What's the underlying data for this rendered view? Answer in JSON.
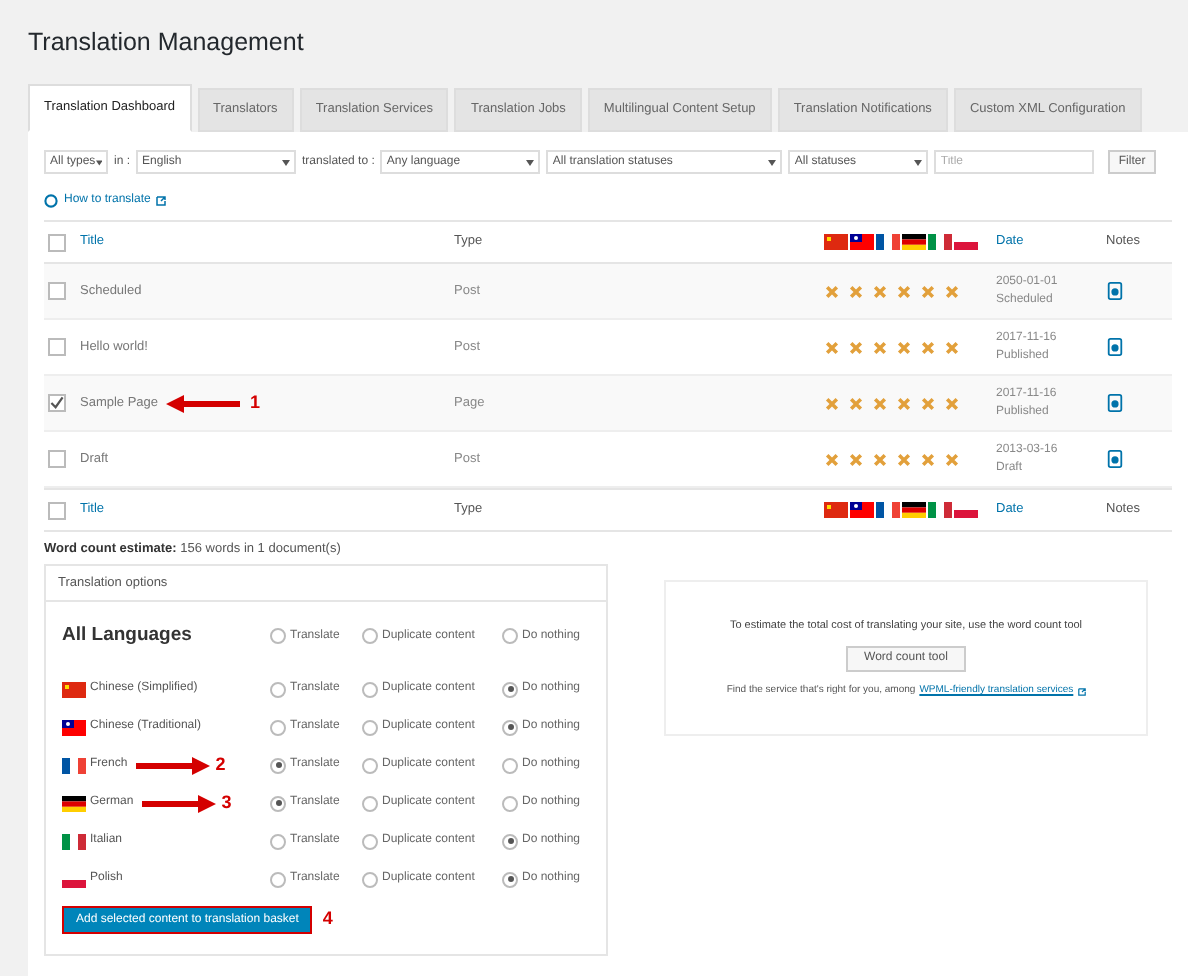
{
  "title": "Translation Management",
  "tabs": [
    {
      "label": "Translation Dashboard",
      "selected": true
    },
    {
      "label": "Translators",
      "selected": false
    },
    {
      "label": "Translation Services",
      "selected": false
    },
    {
      "label": "Translation Jobs",
      "selected": false
    },
    {
      "label": "Multilingual Content Setup",
      "selected": false
    },
    {
      "label": "Translation Notifications",
      "selected": false
    },
    {
      "label": "Custom XML Configuration",
      "selected": false
    }
  ],
  "filters": {
    "type": "All types",
    "in_label": "in :",
    "language": "English",
    "to_label": "translated to :",
    "target": "Any language",
    "translation_status": "All translation statuses",
    "status": "All statuses",
    "title_placeholder": "Title",
    "filter_button": "Filter"
  },
  "how_to_link": "How to translate",
  "table": {
    "header": {
      "checked": false,
      "title": "Title",
      "type": "Type",
      "date": "Date",
      "notes": "Notes",
      "flags": [
        {
          "kind": "cn"
        },
        {
          "kind": "tw"
        },
        {
          "kind": "fr"
        },
        {
          "kind": "de"
        },
        {
          "kind": "it"
        },
        {
          "kind": "pl"
        }
      ]
    },
    "footer": {
      "checked": false,
      "title": "Title",
      "type": "Type",
      "date": "Date",
      "notes": "Notes",
      "flags": [
        {
          "kind": "cn"
        },
        {
          "kind": "tw"
        },
        {
          "kind": "fr"
        },
        {
          "kind": "de"
        },
        {
          "kind": "it"
        },
        {
          "kind": "pl"
        }
      ]
    },
    "rows": [
      {
        "checked": false,
        "title": "Scheduled",
        "type": "Post",
        "date": "2050-01-01",
        "status": "Scheduled"
      },
      {
        "checked": false,
        "title": "Hello world!",
        "type": "Post",
        "date": "2017-11-16",
        "status": "Published"
      },
      {
        "checked": true,
        "title": "Sample Page",
        "type": "Page",
        "date": "2017-11-16",
        "status": "Published",
        "annotation": "1"
      },
      {
        "checked": false,
        "title": "Draft",
        "type": "Post",
        "date": "2013-03-16",
        "status": "Draft"
      }
    ]
  },
  "word_count": {
    "label": "Word count estimate:",
    "text": "156 words in 1 document(s)"
  },
  "options": {
    "header": "Translation options",
    "all_label": "All Languages",
    "all_options": [
      {
        "label": "Translate",
        "selected": false
      },
      {
        "label": "Duplicate content",
        "selected": false
      },
      {
        "label": "Do nothing",
        "selected": false
      }
    ],
    "languages": [
      {
        "kind": "cn",
        "name": "Chinese (Simplified)",
        "options": [
          {
            "label": "Translate",
            "selected": false
          },
          {
            "label": "Duplicate content",
            "selected": false
          },
          {
            "label": "Do nothing",
            "selected": true
          }
        ]
      },
      {
        "kind": "tw",
        "name": "Chinese (Traditional)",
        "options": [
          {
            "label": "Translate",
            "selected": false
          },
          {
            "label": "Duplicate content",
            "selected": false
          },
          {
            "label": "Do nothing",
            "selected": true
          }
        ]
      },
      {
        "kind": "fr",
        "name": "French",
        "annotation": "2",
        "options": [
          {
            "label": "Translate",
            "selected": true
          },
          {
            "label": "Duplicate content",
            "selected": false
          },
          {
            "label": "Do nothing",
            "selected": false
          }
        ]
      },
      {
        "kind": "de",
        "name": "German",
        "annotation": "3",
        "options": [
          {
            "label": "Translate",
            "selected": true
          },
          {
            "label": "Duplicate content",
            "selected": false
          },
          {
            "label": "Do nothing",
            "selected": false
          }
        ]
      },
      {
        "kind": "it",
        "name": "Italian",
        "options": [
          {
            "label": "Translate",
            "selected": false
          },
          {
            "label": "Duplicate content",
            "selected": false
          },
          {
            "label": "Do nothing",
            "selected": true
          }
        ]
      },
      {
        "kind": "pl",
        "name": "Polish",
        "options": [
          {
            "label": "Translate",
            "selected": false
          },
          {
            "label": "Duplicate content",
            "selected": false
          },
          {
            "label": "Do nothing",
            "selected": true
          }
        ]
      }
    ],
    "button": "Add selected content to translation basket",
    "button_annotation": "4"
  },
  "estimate": {
    "text": "To estimate the total cost of translating your site, use the word count tool",
    "button": "Word count tool",
    "find_text": "Find the service that's right for you, among",
    "link": "WPML-friendly translation services"
  }
}
